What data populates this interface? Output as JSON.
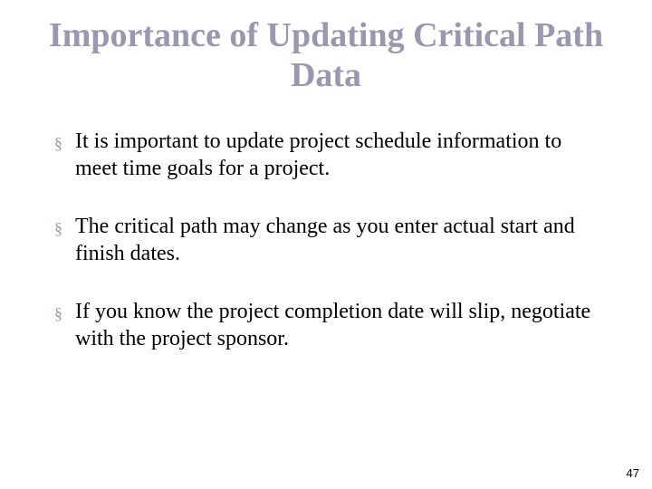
{
  "slide": {
    "title": "Importance of Updating Critical Path Data",
    "bullets": [
      "It is important to update project schedule information to meet time goals for a project.",
      "The critical path may change as you enter actual start and finish dates.",
      "If you know the project completion date will slip, negotiate with the project sponsor."
    ],
    "page_number": "47",
    "bullet_glyph": "§"
  }
}
